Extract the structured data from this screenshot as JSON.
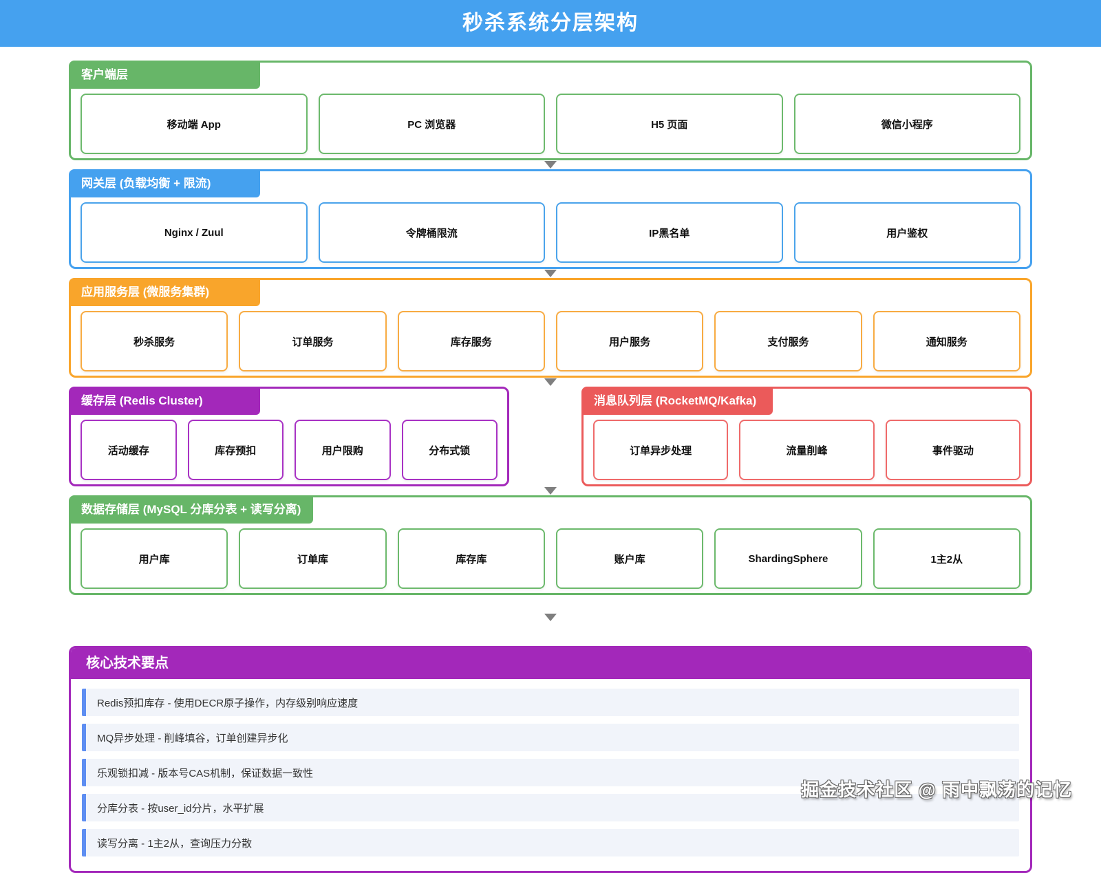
{
  "title": "秒杀系统分层架构",
  "colors": {
    "title_bar": "#45a1ef",
    "client_layer": "#67b668",
    "gateway_layer": "#45a1ef",
    "service_layer": "#f9a52b",
    "cache_layer": "#a328ba",
    "mq_layer": "#eb5a5a",
    "storage_layer": "#67b668",
    "keypoints_header": "#a328ba",
    "keypoint_item_accent": "#5e8ef2",
    "arrow": "#7f7f7f"
  },
  "layers": {
    "client": {
      "label": "客户端层",
      "boxes": [
        "移动端 App",
        "PC 浏览器",
        "H5 页面",
        "微信小程序"
      ]
    },
    "gateway": {
      "label": "网关层 (负载均衡 + 限流)",
      "boxes": [
        "Nginx / Zuul",
        "令牌桶限流",
        "IP黑名单",
        "用户鉴权"
      ]
    },
    "service": {
      "label": "应用服务层 (微服务集群)",
      "boxes": [
        "秒杀服务",
        "订单服务",
        "库存服务",
        "用户服务",
        "支付服务",
        "通知服务"
      ]
    },
    "cache": {
      "label": "缓存层 (Redis Cluster)",
      "boxes": [
        "活动缓存",
        "库存预扣",
        "用户限购",
        "分布式锁"
      ]
    },
    "mq": {
      "label": "消息队列层 (RocketMQ/Kafka)",
      "boxes": [
        "订单异步处理",
        "流量削峰",
        "事件驱动"
      ]
    },
    "storage": {
      "label": "数据存储层 (MySQL 分库分表 + 读写分离)",
      "boxes": [
        "用户库",
        "订单库",
        "库存库",
        "账户库",
        "ShardingSphere",
        "1主2从"
      ]
    }
  },
  "keypoints": {
    "title": "核心技术要点",
    "items": [
      "Redis预扣库存 - 使用DECR原子操作，内存级别响应速度",
      "MQ异步处理 - 削峰填谷，订单创建异步化",
      "乐观锁扣减 - 版本号CAS机制，保证数据一致性",
      "分库分表 - 按user_id分片，水平扩展",
      "读写分离 - 1主2从，查询压力分散"
    ]
  },
  "watermark": "掘金技术社区 @ 雨中飘荡的记忆"
}
